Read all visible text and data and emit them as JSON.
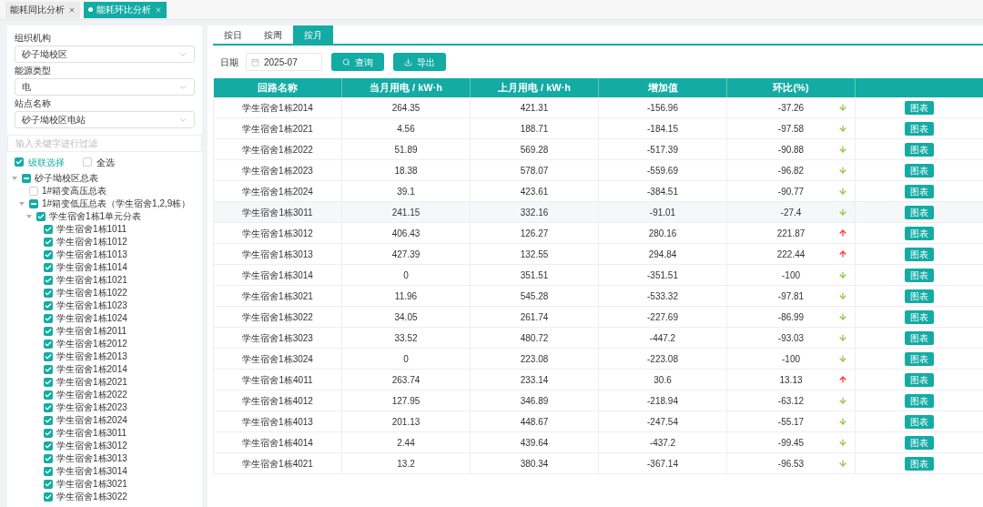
{
  "tabs": [
    {
      "label": "能耗同比分析",
      "selected": false
    },
    {
      "label": "能耗环比分析",
      "selected": true
    }
  ],
  "filters": [
    {
      "label": "组织机构",
      "value": "砂子坳校区"
    },
    {
      "label": "能源类型",
      "value": "电"
    },
    {
      "label": "站点名称",
      "value": "砂子坳校区电站"
    }
  ],
  "tree_filter": {
    "placeholder": "输入关键字进行过滤"
  },
  "cascade": {
    "label": "级联选择",
    "checked": true
  },
  "select_all": {
    "label": "全选",
    "checked": false
  },
  "tree": [
    {
      "label": "砂子坳校区总表",
      "checked": true,
      "indeterminate": true,
      "expanded": true,
      "children": [
        {
          "label": "1#箱变高压总表",
          "checked": false,
          "indeterminate": false
        },
        {
          "label": "1#箱变低压总表（学生宿舍1,2,9栋）",
          "checked": true,
          "indeterminate": true,
          "expanded": true,
          "children": [
            {
              "label": "学生宿舍1栋1单元分表",
              "checked": true,
              "indeterminate": false,
              "expanded": true,
              "children": [
                {
                  "label": "学生宿舍1栋1011",
                  "checked": true,
                  "indeterminate": false
                },
                {
                  "label": "学生宿舍1栋1012",
                  "checked": true,
                  "indeterminate": false
                },
                {
                  "label": "学生宿舍1栋1013",
                  "checked": true,
                  "indeterminate": false
                },
                {
                  "label": "学生宿舍1栋1014",
                  "checked": true,
                  "indeterminate": false
                },
                {
                  "label": "学生宿舍1栋1021",
                  "checked": true,
                  "indeterminate": false
                },
                {
                  "label": "学生宿舍1栋1022",
                  "checked": true,
                  "indeterminate": false
                },
                {
                  "label": "学生宿舍1栋1023",
                  "checked": true,
                  "indeterminate": false
                },
                {
                  "label": "学生宿舍1栋1024",
                  "checked": true,
                  "indeterminate": false
                },
                {
                  "label": "学生宿舍1栋2011",
                  "checked": true,
                  "indeterminate": false
                },
                {
                  "label": "学生宿舍1栋2012",
                  "checked": true,
                  "indeterminate": false
                },
                {
                  "label": "学生宿舍1栋2013",
                  "checked": true,
                  "indeterminate": false
                },
                {
                  "label": "学生宿舍1栋2014",
                  "checked": true,
                  "indeterminate": false
                },
                {
                  "label": "学生宿舍1栋2021",
                  "checked": true,
                  "indeterminate": false
                },
                {
                  "label": "学生宿舍1栋2022",
                  "checked": true,
                  "indeterminate": false
                },
                {
                  "label": "学生宿舍1栋2023",
                  "checked": true,
                  "indeterminate": false
                },
                {
                  "label": "学生宿舍1栋2024",
                  "checked": true,
                  "indeterminate": false
                },
                {
                  "label": "学生宿舍1栋3011",
                  "checked": true,
                  "indeterminate": false
                },
                {
                  "label": "学生宿舍1栋3012",
                  "checked": true,
                  "indeterminate": false
                },
                {
                  "label": "学生宿舍1栋3013",
                  "checked": true,
                  "indeterminate": false
                },
                {
                  "label": "学生宿舍1栋3014",
                  "checked": true,
                  "indeterminate": false
                },
                {
                  "label": "学生宿舍1栋3021",
                  "checked": true,
                  "indeterminate": false
                },
                {
                  "label": "学生宿舍1栋3022",
                  "checked": true,
                  "indeterminate": false
                }
              ]
            }
          ]
        }
      ]
    }
  ],
  "period_tabs": [
    {
      "label": "按日",
      "selected": false
    },
    {
      "label": "按周",
      "selected": false
    },
    {
      "label": "按月",
      "selected": true
    }
  ],
  "date": {
    "label": "日期",
    "value": "2025-07"
  },
  "buttons": [
    {
      "label": "查询",
      "kind": "search"
    },
    {
      "label": "导出",
      "kind": "export"
    }
  ],
  "table": {
    "columns": [
      "回路名称",
      "当月用电 / kW·h",
      "上月用电 / kW·h",
      "增加值",
      "环比(%)"
    ],
    "rows": [
      {
        "name": "学生宿舍1栋2014",
        "current": "264.35",
        "previous": "421.31",
        "increase": "-156.96",
        "ratio": "-37.26",
        "increased": false,
        "action": "图表"
      },
      {
        "name": "学生宿舍1栋2021",
        "current": "4.56",
        "previous": "188.71",
        "increase": "-184.15",
        "ratio": "-97.58",
        "increased": false,
        "action": "图表"
      },
      {
        "name": "学生宿舍1栋2022",
        "current": "51.89",
        "previous": "569.28",
        "increase": "-517.39",
        "ratio": "-90.88",
        "increased": false,
        "action": "图表"
      },
      {
        "name": "学生宿舍1栋2023",
        "current": "18.38",
        "previous": "578.07",
        "increase": "-559.69",
        "ratio": "-96.82",
        "increased": false,
        "action": "图表"
      },
      {
        "name": "学生宿舍1栋2024",
        "current": "39.1",
        "previous": "423.61",
        "increase": "-384.51",
        "ratio": "-90.77",
        "increased": false,
        "action": "图表"
      },
      {
        "name": "学生宿舍1栋3011",
        "current": "241.15",
        "previous": "332.16",
        "increase": "-91.01",
        "ratio": "-27.4",
        "increased": false,
        "action": "图表"
      },
      {
        "name": "学生宿舍1栋3012",
        "current": "406.43",
        "previous": "126.27",
        "increase": "280.16",
        "ratio": "221.87",
        "increased": true,
        "action": "图表"
      },
      {
        "name": "学生宿舍1栋3013",
        "current": "427.39",
        "previous": "132.55",
        "increase": "294.84",
        "ratio": "222.44",
        "increased": true,
        "action": "图表"
      },
      {
        "name": "学生宿舍1栋3014",
        "current": "0",
        "previous": "351.51",
        "increase": "-351.51",
        "ratio": "-100",
        "increased": false,
        "action": "图表"
      },
      {
        "name": "学生宿舍1栋3021",
        "current": "11.96",
        "previous": "545.28",
        "increase": "-533.32",
        "ratio": "-97.81",
        "increased": false,
        "action": "图表"
      },
      {
        "name": "学生宿舍1栋3022",
        "current": "34.05",
        "previous": "261.74",
        "increase": "-227.69",
        "ratio": "-86.99",
        "increased": false,
        "action": "图表"
      },
      {
        "name": "学生宿舍1栋3023",
        "current": "33.52",
        "previous": "480.72",
        "increase": "-447.2",
        "ratio": "-93.03",
        "increased": false,
        "action": "图表"
      },
      {
        "name": "学生宿舍1栋3024",
        "current": "0",
        "previous": "223.08",
        "increase": "-223.08",
        "ratio": "-100",
        "increased": false,
        "action": "图表"
      },
      {
        "name": "学生宿舍1栋4011",
        "current": "263.74",
        "previous": "233.14",
        "increase": "30.6",
        "ratio": "13.13",
        "increased": true,
        "action": "图表"
      },
      {
        "name": "学生宿舍1栋4012",
        "current": "127.95",
        "previous": "346.89",
        "increase": "-218.94",
        "ratio": "-63.12",
        "increased": false,
        "action": "图表"
      },
      {
        "name": "学生宿舍1栋4013",
        "current": "201.13",
        "previous": "448.67",
        "increase": "-247.54",
        "ratio": "-55.17",
        "increased": false,
        "action": "图表"
      },
      {
        "name": "学生宿舍1栋4014",
        "current": "2.44",
        "previous": "439.64",
        "increase": "-437.2",
        "ratio": "-99.45",
        "increased": false,
        "action": "图表"
      },
      {
        "name": "学生宿舍1栋4021",
        "current": "13.2",
        "previous": "380.34",
        "increase": "-367.14",
        "ratio": "-96.53",
        "increased": false,
        "action": "图表"
      }
    ]
  }
}
